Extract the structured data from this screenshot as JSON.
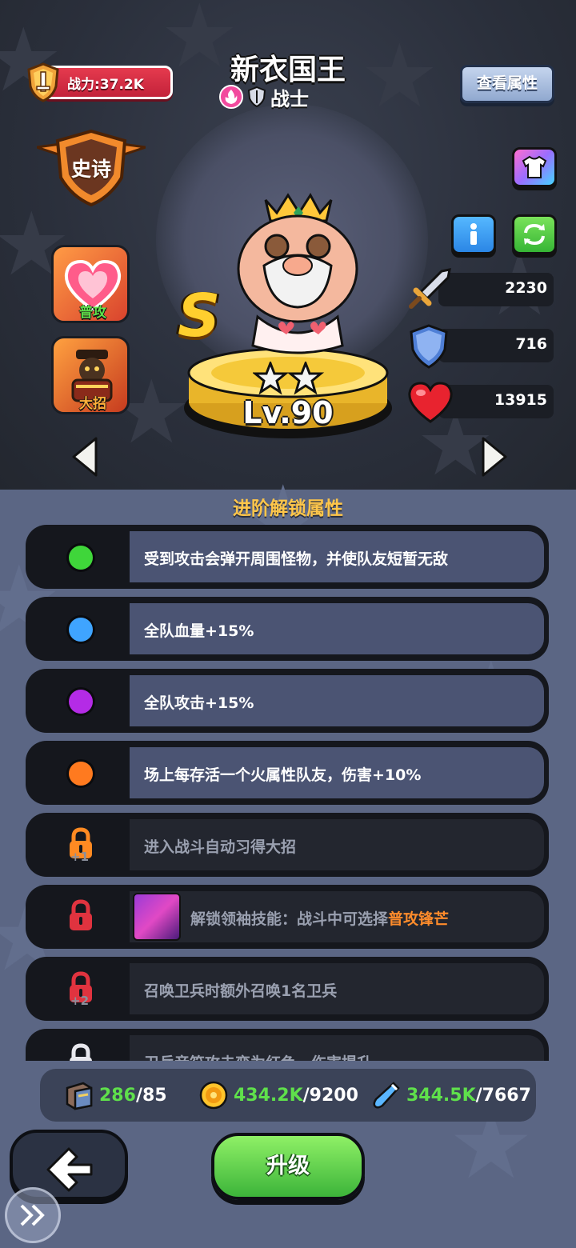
{
  "header": {
    "power_label": "战力:37.2K",
    "hero_name": "新衣国王",
    "class_name": "战士",
    "view_attributes_button": "查看属性",
    "rarity": "史诗",
    "element_icon": "fire-element-icon",
    "class_icon": "shield-class-icon"
  },
  "skills": {
    "basic_label": "普攻",
    "ultimate_label": "大招"
  },
  "hero": {
    "grade": "S",
    "level": "Lv.90",
    "star_count": 2
  },
  "stats": {
    "attack": "2230",
    "defense": "716",
    "hp": "13915"
  },
  "section_title": "进阶解锁属性",
  "attributes": [
    {
      "text": "受到攻击会弹开周围怪物，并使队友短暂无敌",
      "status": "unlocked",
      "color": "#3fd63a"
    },
    {
      "text": "全队血量+15%",
      "status": "unlocked",
      "color": "#3fa4ff"
    },
    {
      "text": "全队攻击+15%",
      "status": "unlocked",
      "color": "#b42be6"
    },
    {
      "text": "场上每存活一个火属性队友，伤害+10%",
      "status": "unlocked",
      "color": "#ff7a1f"
    },
    {
      "text": "进入战斗自动习得大招",
      "status": "locked",
      "lock_color": "#ff8a22",
      "requirement": "+1"
    },
    {
      "text_prefix": "解锁领袖技能：战斗中可选择",
      "text_highlight": "普攻锋芒",
      "status": "locked",
      "lock_color": "#e0333f"
    },
    {
      "text": "召唤卫兵时额外召唤1名卫兵",
      "status": "locked",
      "lock_color": "#e0333f",
      "requirement": "+2"
    },
    {
      "text": "卫兵音符攻击变为红色，伤害提升",
      "status": "locked",
      "lock_color": "#e8e8ee"
    }
  ],
  "resources": {
    "book": {
      "have": "286",
      "need": "/85"
    },
    "gold": {
      "have": "434.2K",
      "need": "/9200"
    },
    "potion": {
      "have": "344.5K",
      "need": "/7667"
    }
  },
  "buttons": {
    "upgrade": "升级"
  },
  "colors": {
    "panel_bg": "#5b6684",
    "hero_bg": "#2a2f3b",
    "upgrade_green": "#5fd44a",
    "resource_have": "#5fe04b",
    "section_title": "#ffc64a"
  }
}
